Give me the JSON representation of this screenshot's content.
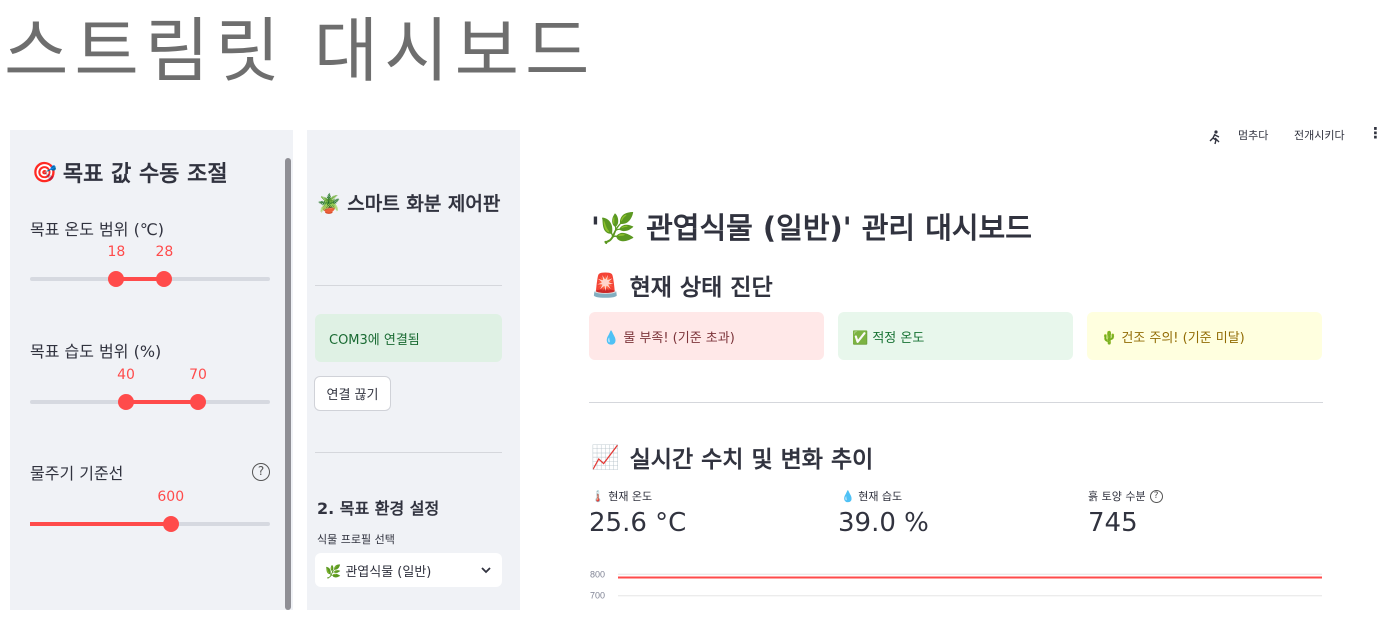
{
  "page": {
    "title": "스트림릿 대시보드"
  },
  "left_panel": {
    "heading": "목표 값 수동 조절",
    "heading_icon": "🎯",
    "sliders": [
      {
        "label": "목표 온도 범위 (℃)",
        "min": 0,
        "max": 50,
        "low": 18,
        "high": 28,
        "low_text": "18",
        "high_text": "28"
      },
      {
        "label": "목표 습도 범위 (%)",
        "min": 0,
        "max": 100,
        "low": 40,
        "high": 70,
        "low_text": "40",
        "high_text": "70"
      },
      {
        "label": "물주기 기준선",
        "min": 0,
        "max": 1023,
        "value": 600,
        "value_text": "600",
        "help": "?"
      }
    ]
  },
  "mid_panel": {
    "title": "스마트 화분 제어판",
    "title_icon": "🪴",
    "connection_status": "COM3에 연결됨",
    "disconnect_label": "연결 끊기",
    "section_title": "2. 목표 환경 설정",
    "select_label": "식물 프로필 선택",
    "select_value": "🌿 관엽식물 (일반)",
    "select_icon": "chevron-down-icon"
  },
  "toolbar": {
    "stop_label": "멈추다",
    "deploy_label": "전개시키다",
    "more_icon": "⋮",
    "run_icon": "running-person-icon"
  },
  "main": {
    "title": "'🌿 관엽식물 (일반)' 관리 대시보드",
    "status_heading": "현재 상태 진단",
    "status_icon": "🚨",
    "alerts": [
      {
        "text": "💧 물 부족! (기준 초과)",
        "bg": "#ffe8e8",
        "color": "#7d353b"
      },
      {
        "text": "✅ 적정 온도",
        "bg": "#e8f7ec",
        "color": "#177233"
      },
      {
        "text": "🌵 건조 주의! (기준 미달)",
        "bg": "#ffffdf",
        "color": "#926c05"
      }
    ],
    "metrics_heading": "실시간 수치 및 변화 추이",
    "metrics_icon": "📈",
    "metrics": [
      {
        "label": "🌡️ 현재 온도",
        "value": "25.6 °C"
      },
      {
        "label": "💧 현재 습도",
        "value": "39.0 %"
      },
      {
        "label": "흙 토양 수분",
        "value": "745",
        "help": "?"
      }
    ]
  },
  "chart_data": {
    "type": "line",
    "y_ticks": [
      "800",
      "700"
    ],
    "series": [
      {
        "values": [
          785,
          785,
          785,
          785,
          785
        ]
      }
    ],
    "color": "#ff4b4b",
    "ylim": [
      680,
      820
    ]
  }
}
